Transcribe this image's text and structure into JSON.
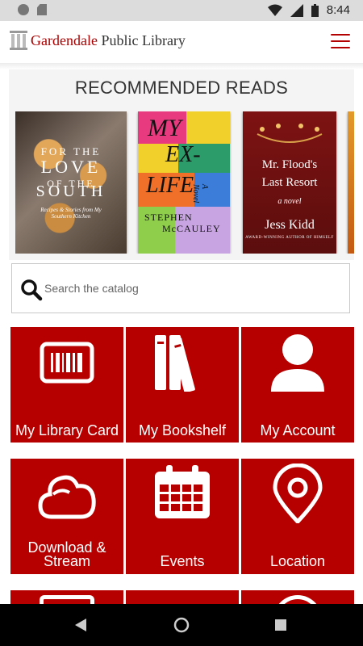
{
  "status_bar": {
    "time": "8:44"
  },
  "header": {
    "title_accent": "Gardendale",
    "title_rest": "Public Library",
    "menu_icon": "hamburger-menu-icon"
  },
  "recommended": {
    "title": "RECOMMENDED READS",
    "books": [
      {
        "line1": "FOR THE",
        "line2": "LOVE",
        "line3": "OF THE",
        "line4": "SOUTH",
        "subtitle": "Recipes & Stories from My Southern Kitchen"
      },
      {
        "title_a": "MY",
        "title_b": "EX-",
        "title_c": "LIFE",
        "author_a": "STEPHEN",
        "author_b": "McCAULEY",
        "tag": "A Novel"
      },
      {
        "title_a": "Mr. Flood's",
        "title_b": "Last Resort",
        "tag": "a novel",
        "author": "Jess Kidd",
        "byline": "AWARD-WINNING AUTHOR OF HIMSELF"
      }
    ]
  },
  "search": {
    "placeholder": "Search the catalog"
  },
  "tiles": [
    {
      "label": "My Library Card",
      "icon": "barcode-card-icon"
    },
    {
      "label": "My Bookshelf",
      "icon": "books-icon"
    },
    {
      "label": "My Account",
      "icon": "user-icon"
    },
    {
      "label_line1": "Download &",
      "label_line2": "Stream",
      "icon": "cloud-icon"
    },
    {
      "label": "Events",
      "icon": "calendar-icon"
    },
    {
      "label": "Location",
      "icon": "map-pin-icon"
    }
  ],
  "colors": {
    "brand_red": "#b60000",
    "accent_red": "#a80000"
  }
}
